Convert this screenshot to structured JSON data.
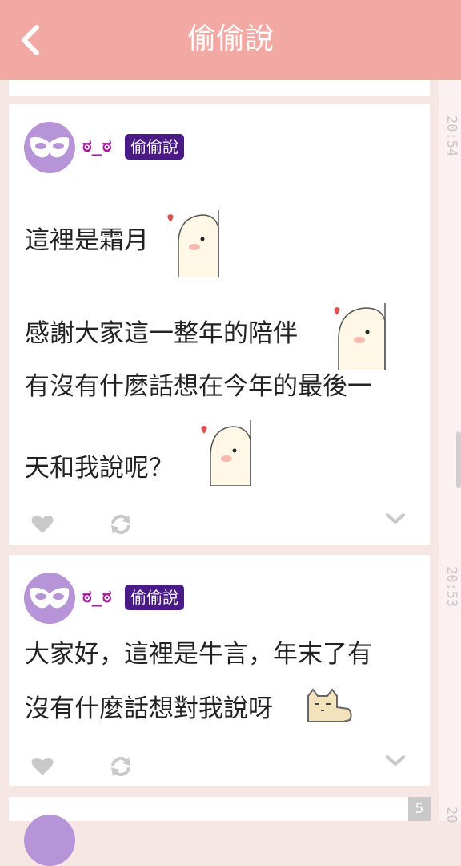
{
  "header": {
    "title": "偷偷說",
    "back_icon": "chevron-left-icon"
  },
  "timeline": {
    "times": [
      "20:54",
      "20:53",
      "20"
    ]
  },
  "pagination": {
    "page": "5"
  },
  "posts": [
    {
      "author": "ಠ_ಠ",
      "badge": "偷偷說",
      "lines": [
        "這裡是霜月",
        "感謝大家這一整年的陪伴",
        "有沒有什麼話想在今年的最後一",
        "天和我說呢？"
      ],
      "stickers": [
        "peeking-bun-sticker",
        "peeking-bun-sticker",
        "peeking-bun-sticker"
      ]
    },
    {
      "author": "ಠ_ಠ",
      "badge": "偷偷說",
      "lines": [
        "大家好，這裡是牛言，年末了有",
        "沒有什麼話想對我說呀"
      ],
      "stickers": [
        "pixel-cat-sticker"
      ]
    }
  ],
  "colors": {
    "header": "#f2a8a3",
    "badge": "#4a1a86",
    "avatar": "#b794d8",
    "name": "#a02098",
    "icon": "#c9c9c9"
  }
}
